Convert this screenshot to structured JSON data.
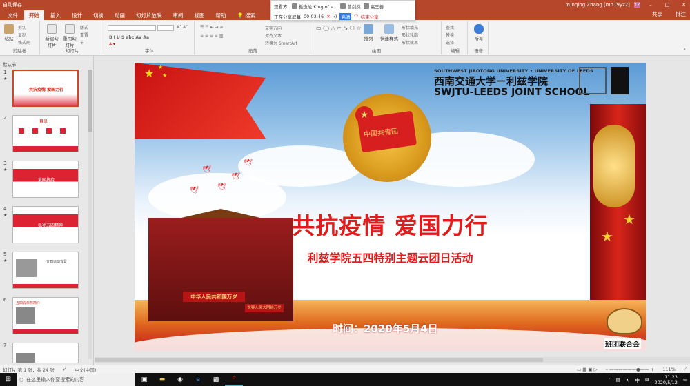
{
  "titlebar": {
    "autosave": "自动保存",
    "user": "Yunqing Zhang [mn19yz2]",
    "user_initials": "YZ"
  },
  "share": {
    "viewers_label": "观看方:",
    "viewers": [
      "栀逸沦 King of e...",
      "曾剑然",
      "高三善"
    ],
    "sharing_label": "正在分享屏幕",
    "duration": "00:03:46",
    "quality": "高清",
    "end_label": "结束分享"
  },
  "tabs": [
    "文件",
    "开始",
    "插入",
    "设计",
    "切换",
    "动画",
    "幻灯片放映",
    "审阅",
    "视图",
    "帮助",
    "搜索"
  ],
  "active_tab": "开始",
  "header_actions": {
    "share": "共享",
    "comment": "批注"
  },
  "ribbon": {
    "clipboard": {
      "label": "剪贴板",
      "paste": "粘贴",
      "cut": "剪切",
      "copy": "复制",
      "format": "格式刷"
    },
    "slides": {
      "label": "幻灯片",
      "new": "新建幻灯片",
      "reuse": "重用幻灯片",
      "layout": "版式",
      "reset": "重置",
      "section": "节"
    },
    "font": {
      "label": "字体"
    },
    "paragraph": {
      "label": "段落",
      "direction": "文字方向",
      "align": "对齐文本",
      "smartart": "转换为 SmartArt"
    },
    "drawing": {
      "label": "绘图",
      "arrange": "排列",
      "quick_styles": "快速样式",
      "fill": "形状填充",
      "outline": "形状轮廓",
      "effects": "形状效果"
    },
    "editing": {
      "label": "编辑",
      "find": "查找",
      "replace": "替换",
      "select": "选择"
    },
    "voice": {
      "label": "语音",
      "dictate": "听写"
    }
  },
  "sidebar": {
    "section": "默认节",
    "thumbs": [
      {
        "num": "1",
        "title": "共抗疫情 爱国力行"
      },
      {
        "num": "2",
        "title": "目录"
      },
      {
        "num": "3",
        "title": "爱国抗疫"
      },
      {
        "num": "4",
        "title": "弘扬五四精神"
      },
      {
        "num": "5",
        "title": "五四运动背景"
      },
      {
        "num": "6",
        "title": "五四青年节简介"
      },
      {
        "num": "7",
        "title": ""
      }
    ]
  },
  "slide": {
    "uni_en": "SOUTHWEST JIAOTONG UNIVERSITY • UNIVERSITY OF LEEDS",
    "uni_cn": "西南交通大学－利兹学院",
    "uni_en2": "SWJTU-LEEDS JOINT SCHOOL",
    "emblem_text": "中国共青团",
    "title": "共抗疫情 爱国力行",
    "subtitle": "利兹学院五四特别主题云团日活动",
    "date": "时间：2020年5月4日",
    "plaque": "中华人民共和国万岁",
    "plaque2": "世界人民大团结万岁",
    "club": "班团联合会"
  },
  "status": {
    "slide_info": "幻灯片 第 1 张，共 24 张",
    "lang": "中文(中国)",
    "zoom": "111%"
  },
  "taskbar": {
    "search_placeholder": "在这里输入你要搜索的内容",
    "time": "11:23",
    "date": "2020/5/12",
    "ime": "中"
  }
}
